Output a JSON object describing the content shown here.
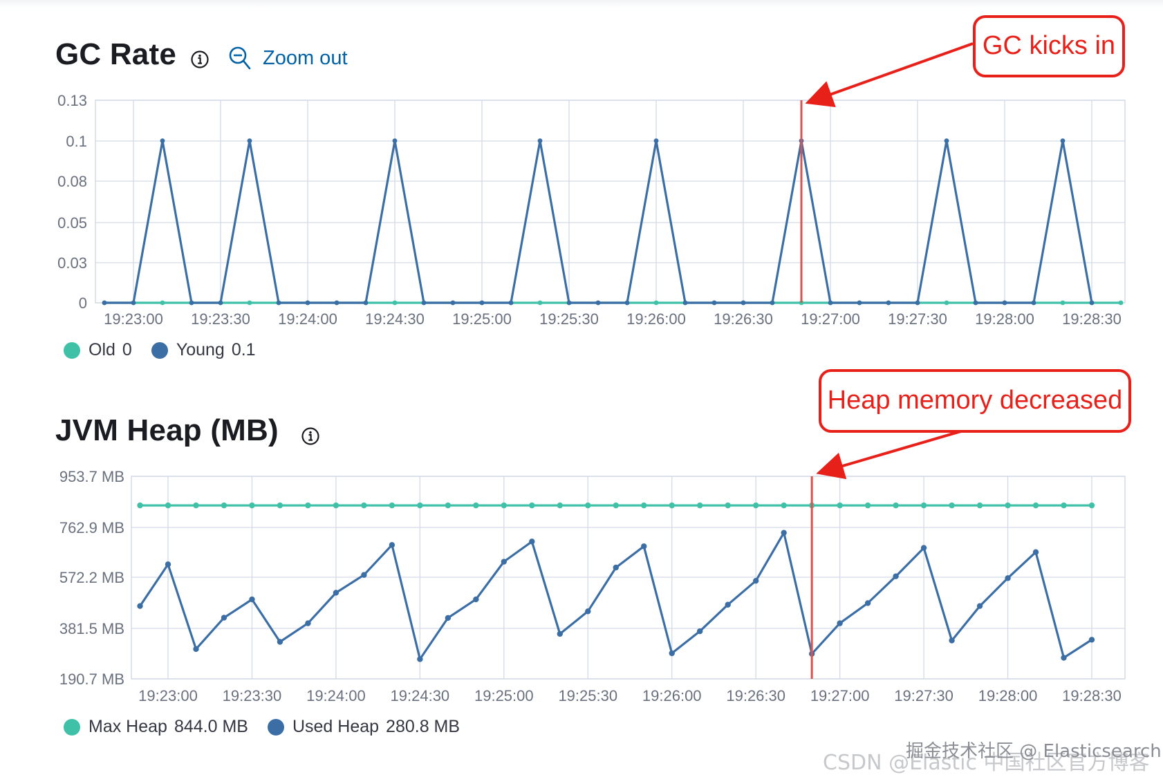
{
  "gc_panel": {
    "title": "GC Rate",
    "zoom_label": "Zoom out",
    "legend": [
      {
        "name": "Old",
        "value": "0",
        "color": "#3fc1a8"
      },
      {
        "name": "Young",
        "value": "0.1",
        "color": "#3a6ea5"
      }
    ]
  },
  "heap_panel": {
    "title": "JVM Heap (MB)",
    "legend": [
      {
        "name": "Max Heap",
        "value": "844.0 MB",
        "color": "#3fc1a8"
      },
      {
        "name": "Used Heap",
        "value": "280.8 MB",
        "color": "#3a6ea5"
      }
    ]
  },
  "annotations": {
    "gc_callout": "GC kicks in",
    "heap_callout": "Heap memory decreased",
    "color": "#e8201a"
  },
  "watermark": {
    "line1": "掘金技术社区 @ Elasticsearch",
    "line2": "CSDN @Elastic 中国社区官方博客"
  },
  "chart_data": [
    {
      "type": "line",
      "title": "GC Rate",
      "x_ticks": [
        "19:23:00",
        "19:23:30",
        "19:24:00",
        "19:24:30",
        "19:25:00",
        "19:25:30",
        "19:26:00",
        "19:26:30",
        "19:27:00",
        "19:27:30",
        "19:28:00",
        "19:28:30"
      ],
      "y_ticks": [
        "0",
        "0.03",
        "0.05",
        "0.08",
        "0.1",
        "0.13"
      ],
      "ylim": [
        0,
        0.125
      ],
      "x_start": "19:22:50",
      "x_step_seconds": 10,
      "series": [
        {
          "name": "Old",
          "color": "#3fc1a8",
          "values": [
            0,
            0,
            0,
            0,
            0,
            0,
            0,
            0,
            0,
            0,
            0,
            0,
            0,
            0,
            0,
            0,
            0,
            0,
            0,
            0,
            0,
            0,
            0,
            0,
            0,
            0,
            0,
            0,
            0,
            0,
            0,
            0,
            0,
            0,
            0,
            0,
            0
          ]
        },
        {
          "name": "Young",
          "color": "#3a6ea5",
          "values": [
            0,
            0,
            0.1,
            0,
            0,
            0.1,
            0,
            0,
            0,
            0,
            0.1,
            0,
            0,
            0,
            0,
            0.1,
            0,
            0,
            0,
            0.1,
            0,
            0,
            0,
            0,
            0.1,
            0,
            0,
            0,
            0,
            0.1,
            0,
            0,
            0,
            0.1,
            0
          ]
        }
      ],
      "marker_x": "19:26:50",
      "grid": true
    },
    {
      "type": "line",
      "title": "JVM Heap (MB)",
      "x_ticks": [
        "19:23:00",
        "19:23:30",
        "19:24:00",
        "19:24:30",
        "19:25:00",
        "19:25:30",
        "19:26:00",
        "19:26:30",
        "19:27:00",
        "19:27:30",
        "19:28:00",
        "19:28:30"
      ],
      "y_ticks": [
        "190.7 MB",
        "381.5 MB",
        "572.2 MB",
        "762.9 MB",
        "953.7 MB"
      ],
      "ylim": [
        190.7,
        953.7
      ],
      "x_start": "19:22:50",
      "x_step_seconds": 10,
      "series": [
        {
          "name": "Max Heap",
          "color": "#3fc1a8",
          "values": [
            844,
            844,
            844,
            844,
            844,
            844,
            844,
            844,
            844,
            844,
            844,
            844,
            844,
            844,
            844,
            844,
            844,
            844,
            844,
            844,
            844,
            844,
            844,
            844,
            844,
            844,
            844,
            844,
            844,
            844,
            844,
            844,
            844,
            844,
            844
          ]
        },
        {
          "name": "Used Heap",
          "color": "#3a6ea5",
          "values": [
            465,
            622,
            303,
            421,
            490,
            330,
            400,
            515,
            582,
            695,
            265,
            420,
            490,
            632,
            708,
            360,
            445,
            610,
            690,
            287,
            370,
            470,
            560,
            741,
            285,
            400,
            476,
            577,
            684,
            335,
            465,
            570,
            668,
            270,
            338
          ]
        }
      ],
      "marker_x": "19:26:50",
      "grid": true
    }
  ]
}
